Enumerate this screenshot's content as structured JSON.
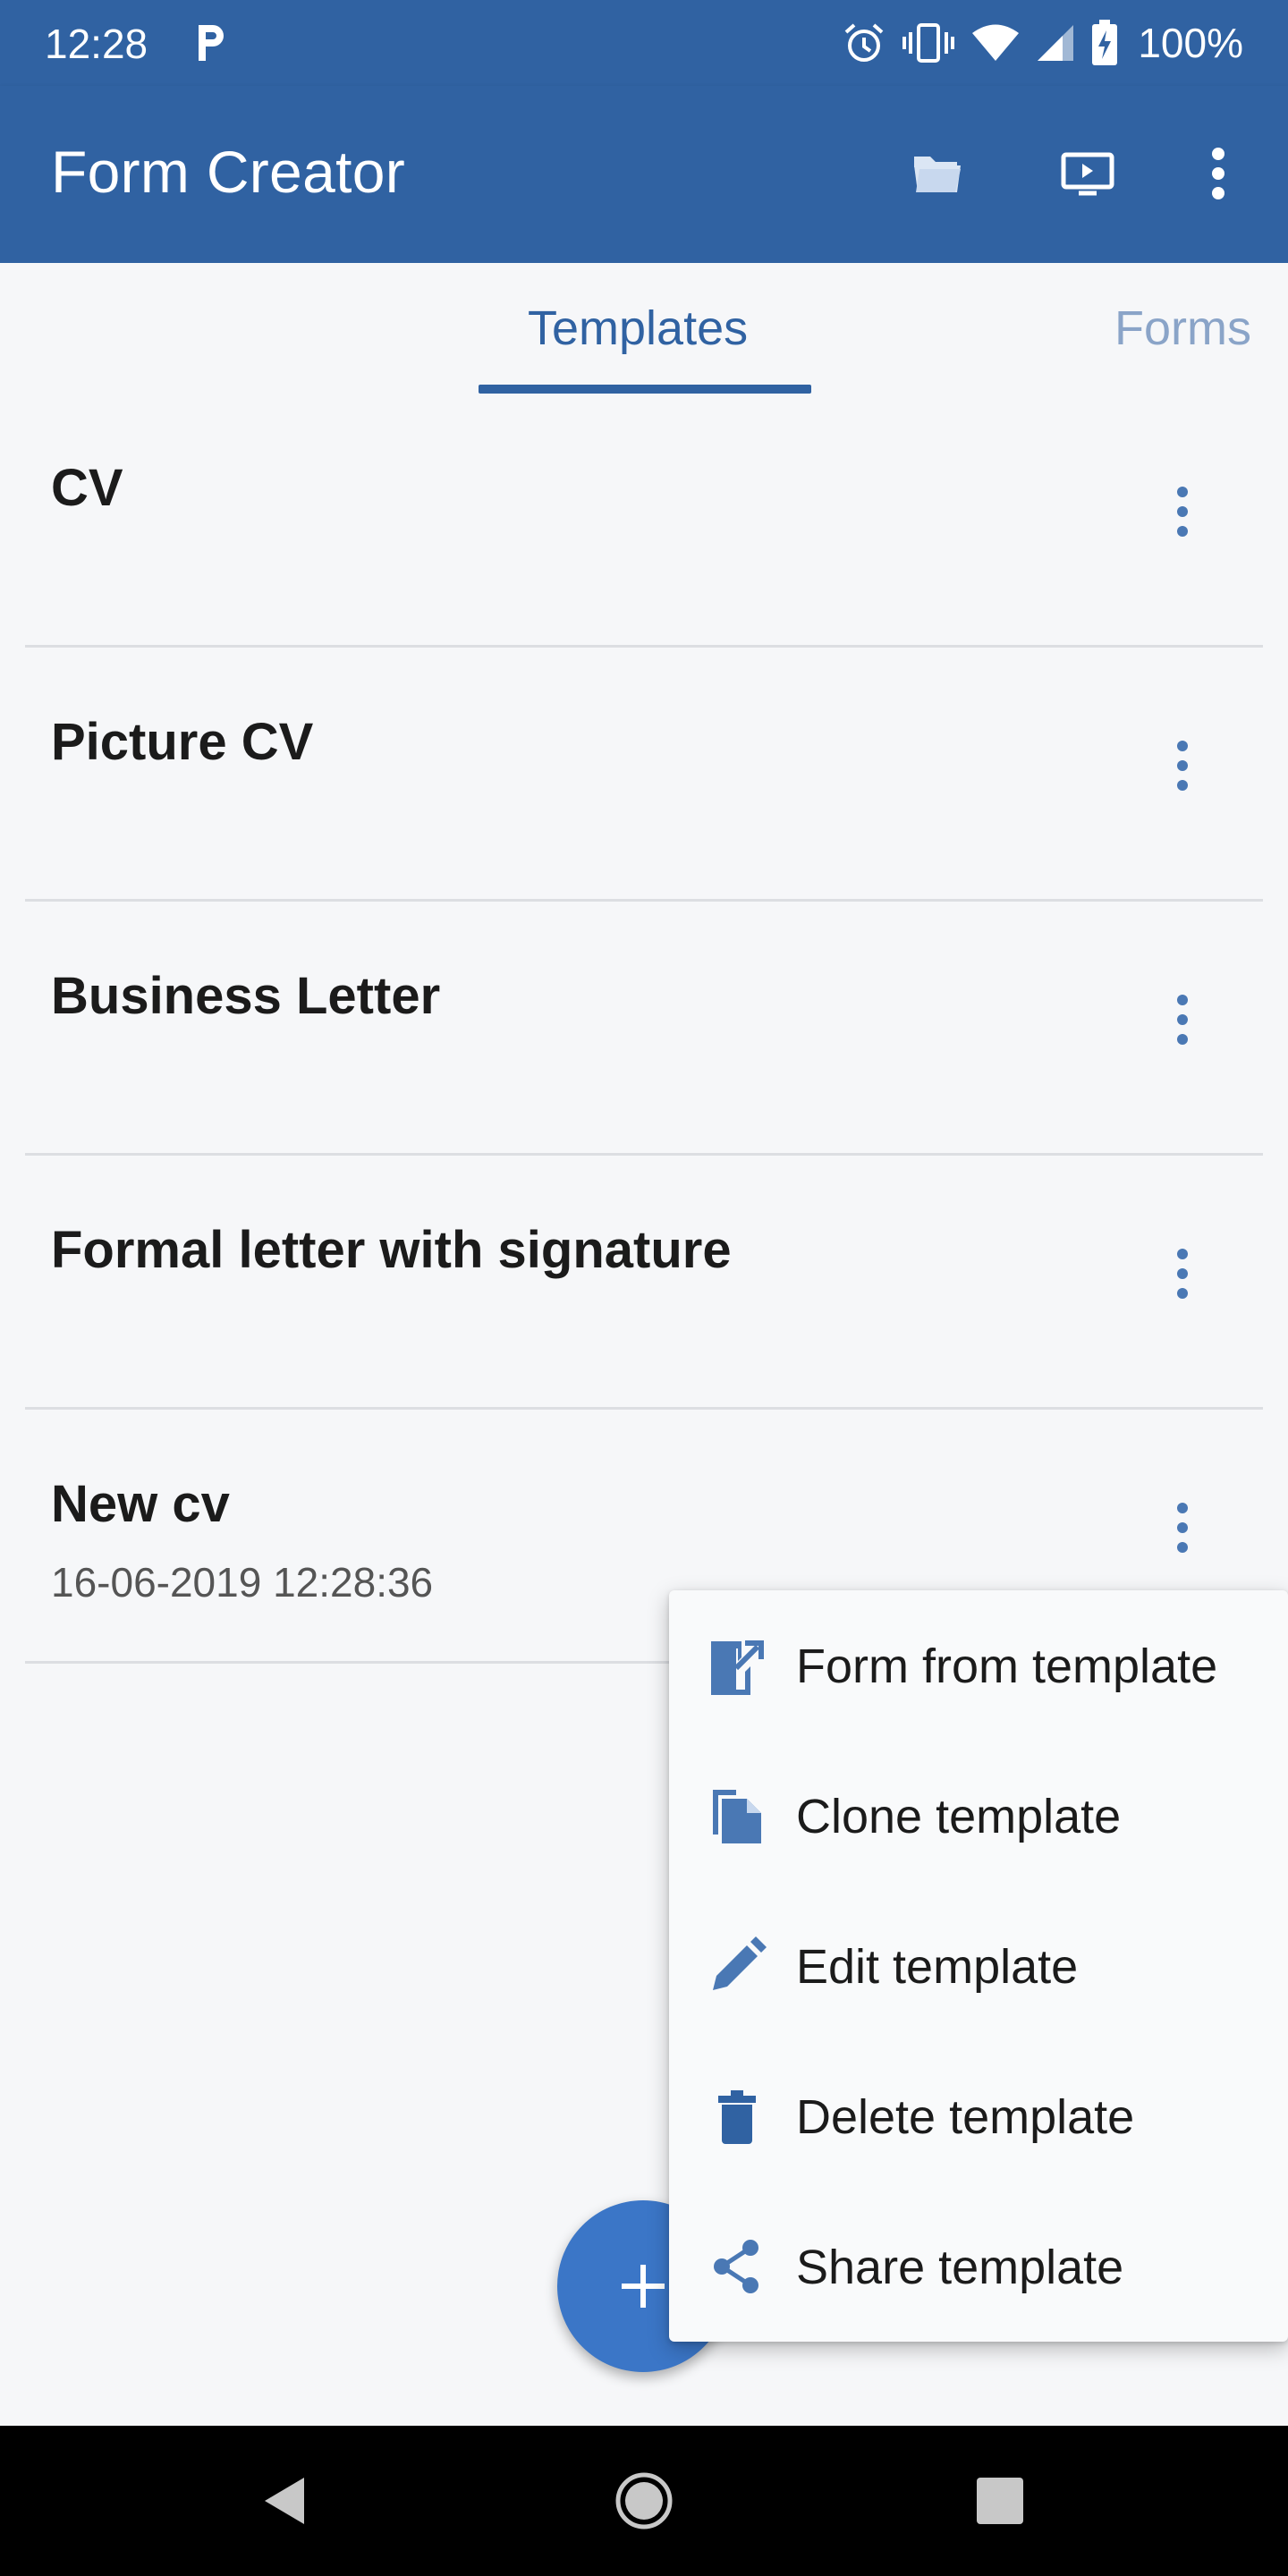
{
  "status_bar": {
    "time": "12:28",
    "battery": "100%",
    "icons": [
      "parking-icon",
      "alarm-icon",
      "vibrate-icon",
      "wifi-icon",
      "signal-icon",
      "battery-charging-icon"
    ]
  },
  "app_bar": {
    "title": "Form Creator",
    "actions": [
      "folder-icon",
      "present-icon",
      "overflow-menu-icon"
    ]
  },
  "tabs": [
    {
      "label": "Templates",
      "selected": true
    },
    {
      "label": "Forms",
      "selected": false
    }
  ],
  "templates": [
    {
      "title": "CV",
      "date": ""
    },
    {
      "title": "Picture CV",
      "date": ""
    },
    {
      "title": "Business Letter",
      "date": ""
    },
    {
      "title": "Formal letter with signature",
      "date": ""
    },
    {
      "title": "New cv",
      "date": "16-06-2019 12:28:36"
    }
  ],
  "context_menu": {
    "items": [
      {
        "label": "Form from template",
        "icon": "form-from-template-icon"
      },
      {
        "label": "Clone template",
        "icon": "clone-icon"
      },
      {
        "label": "Edit template",
        "icon": "pencil-icon"
      },
      {
        "label": "Delete template",
        "icon": "trash-icon"
      },
      {
        "label": "Share template",
        "icon": "share-icon"
      }
    ]
  },
  "fab": {
    "icon": "plus-icon"
  },
  "colors": {
    "primary": "#3062a2",
    "fab": "#3b76c7",
    "inactive_tab": "#8aa4c8",
    "icon_blue": "#4a78b4"
  }
}
